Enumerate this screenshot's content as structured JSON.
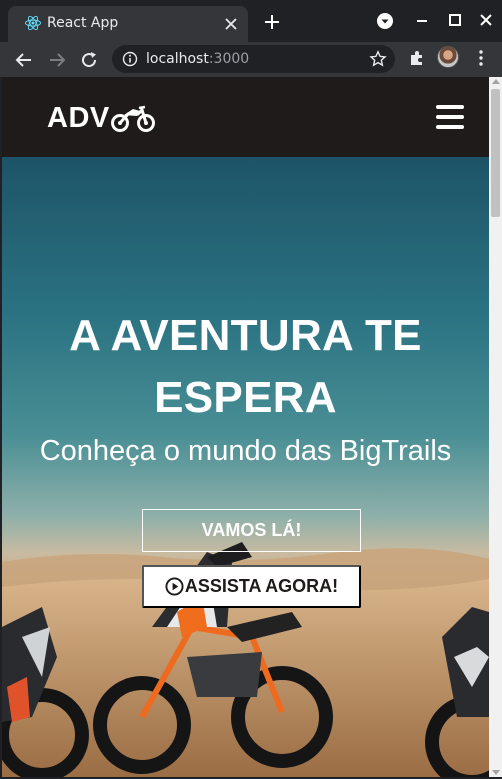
{
  "browser": {
    "tab_title": "React App",
    "url_host": "localhost",
    "url_port": ":3000"
  },
  "site": {
    "logo_text": "ADV",
    "hero_title_line1": "A AVENTURA TE",
    "hero_title_line2": "ESPERA",
    "hero_subtitle": "Conheça o mundo das BigTrails",
    "primary_button": "VAMOS LÁ!",
    "secondary_button": "ASSISTA AGORA!"
  },
  "icons": {
    "favicon": "react-icon",
    "logo": "motorcycle-icon",
    "menu": "hamburger-menu-icon",
    "play": "play-circle-icon"
  },
  "colors": {
    "header_bg": "#1e1b1a",
    "hero_sky": "#2a7282",
    "sand": "#c89f72",
    "button_text": "#1e1b1a"
  }
}
